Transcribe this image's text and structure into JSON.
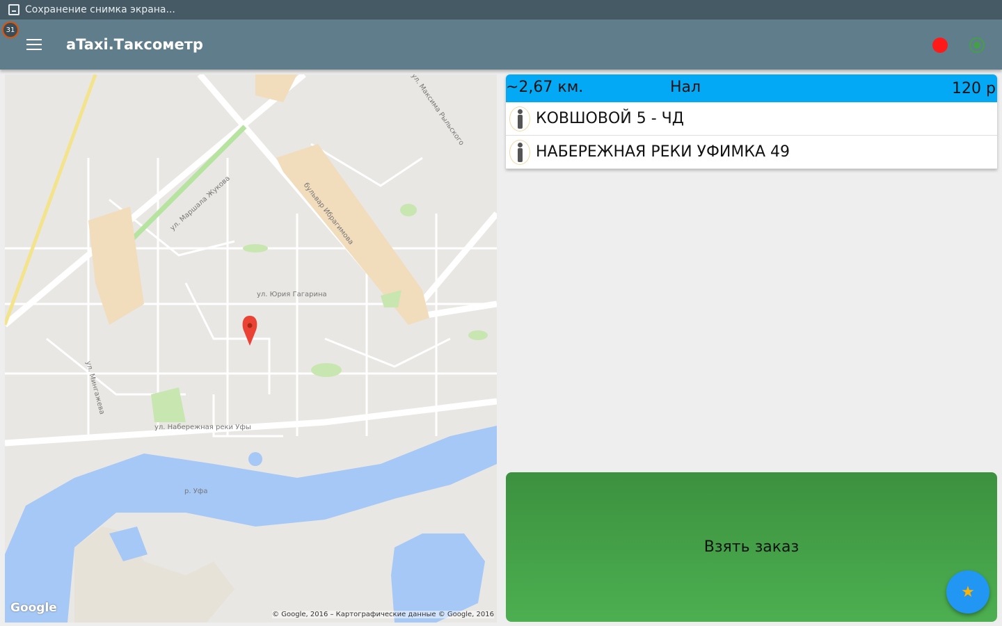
{
  "status_bar": {
    "notification_text": "Сохранение снимка экрана..."
  },
  "app_bar": {
    "badge_count": "31",
    "title": "aTaxi.Таксометр",
    "menu_icon": "menu-icon",
    "status_red_color": "#ff1a1a",
    "status_green_color": "#43a047"
  },
  "map": {
    "logo": "Google",
    "copyright": "© Google, 2016 – Картографические данные © Google, 2016",
    "streets": [
      "ул. Юрия Гагарина",
      "ул. Маршала Жукова",
      "бульвар Ибрагимова",
      "ул. Набережная реки Уфы",
      "ул. Мингажева",
      "ул. Максима Рыльского",
      "р. Уфа"
    ]
  },
  "order": {
    "distance": "~2,67 км.",
    "payment": "Нал",
    "price": "120 р",
    "addresses": [
      {
        "text": "КОВШОВОЙ 5 - ЧД"
      },
      {
        "text": "НАБЕРЕЖНАЯ РЕКИ УФИМКА 49"
      }
    ]
  },
  "take_order_button": {
    "label": "Взять заказ"
  },
  "fab": {
    "icon": "star-icon",
    "symbol": "★"
  },
  "colors": {
    "appbar": "#607d8b",
    "statusbar": "#455a64",
    "order_header": "#03a9f4",
    "take_button": "#43a047",
    "fab": "#2196f3"
  }
}
